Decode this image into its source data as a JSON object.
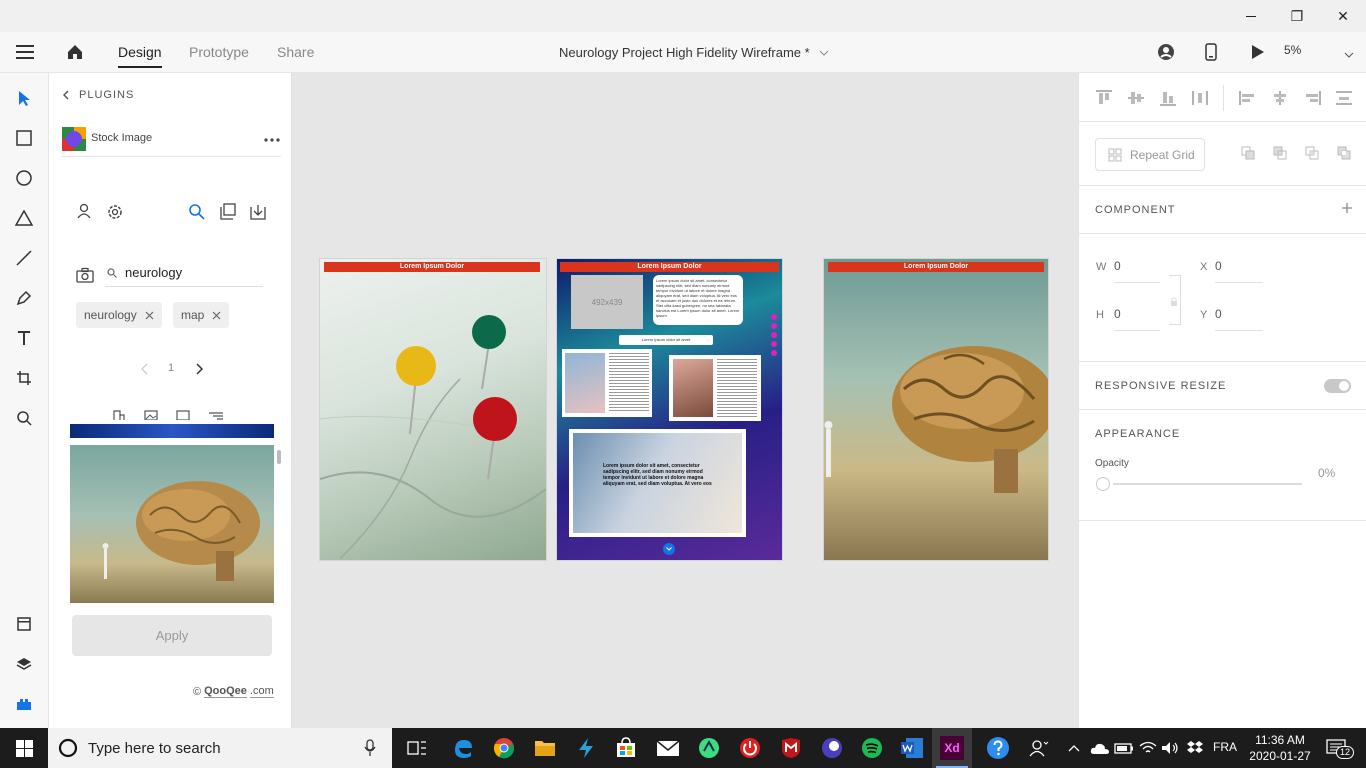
{
  "window": {
    "minimize": "—",
    "restore": "❐",
    "close": "✕"
  },
  "header": {
    "tabs": [
      "Design",
      "Prototype",
      "Share"
    ],
    "doc_title": "Neurology Project High Fidelity Wireframe *",
    "zoom": "5%"
  },
  "plugins": {
    "back_label": "PLUGINS",
    "plugin_name": "Stock Image",
    "search_value": "neurology",
    "tags": [
      "neurology",
      "map"
    ],
    "page": "1",
    "apply_label": "Apply",
    "credit": "QooQee",
    "credit_suffix": ".com"
  },
  "artboards": [
    {
      "bar_text": "Lorem Ipsum Dolor",
      "dots": "•••"
    },
    {
      "bar_text": "Lorem Ipsum Dolor",
      "dots": "•••",
      "placeholder": "492x439",
      "text_block": "Lorem ipsum dolor sit amet, consectetur sadipscing elitr, sed diam nonumy eirmod tempor invidunt ut labore et dolore magna aliquyam erat, sed diam voluptua. At vero eos et accusam et justo duo dolores et ea rebum. Stet clita kasd gubergren, no sea takimata sanctus est Lorem ipsum dolor sit amet. Lorem ipsum",
      "button_text": "Lorem Ipsum dolor sit amet",
      "overlay_text": "Lorem ipsum dolor sit amet, consectetur sadipscing elitr, sed diam nonumy eirmod tempor invidunt ut labore et dolore magna aliquyam erat, sed diam voluptua. At vero eos"
    },
    {
      "bar_text": "Lorem Ipsum Dolor",
      "dots": "•••"
    }
  ],
  "properties": {
    "repeat_grid": "Repeat Grid",
    "component": "COMPONENT",
    "w_label": "W",
    "w_value": "0",
    "x_label": "X",
    "x_value": "0",
    "h_label": "H",
    "h_value": "0",
    "y_label": "Y",
    "y_value": "0",
    "responsive_resize": "RESPONSIVE RESIZE",
    "appearance": "APPEARANCE",
    "opacity_label": "Opacity",
    "opacity_value": "0%"
  },
  "taskbar": {
    "search_placeholder": "Type here to search",
    "language": "FRA",
    "time": "11:36 AM",
    "date": "2020-01-27",
    "notifications": "12"
  },
  "colors": {
    "accent": "#1473e6",
    "bar_red": "#d9341c",
    "taskbar": "#1c1c1c"
  }
}
